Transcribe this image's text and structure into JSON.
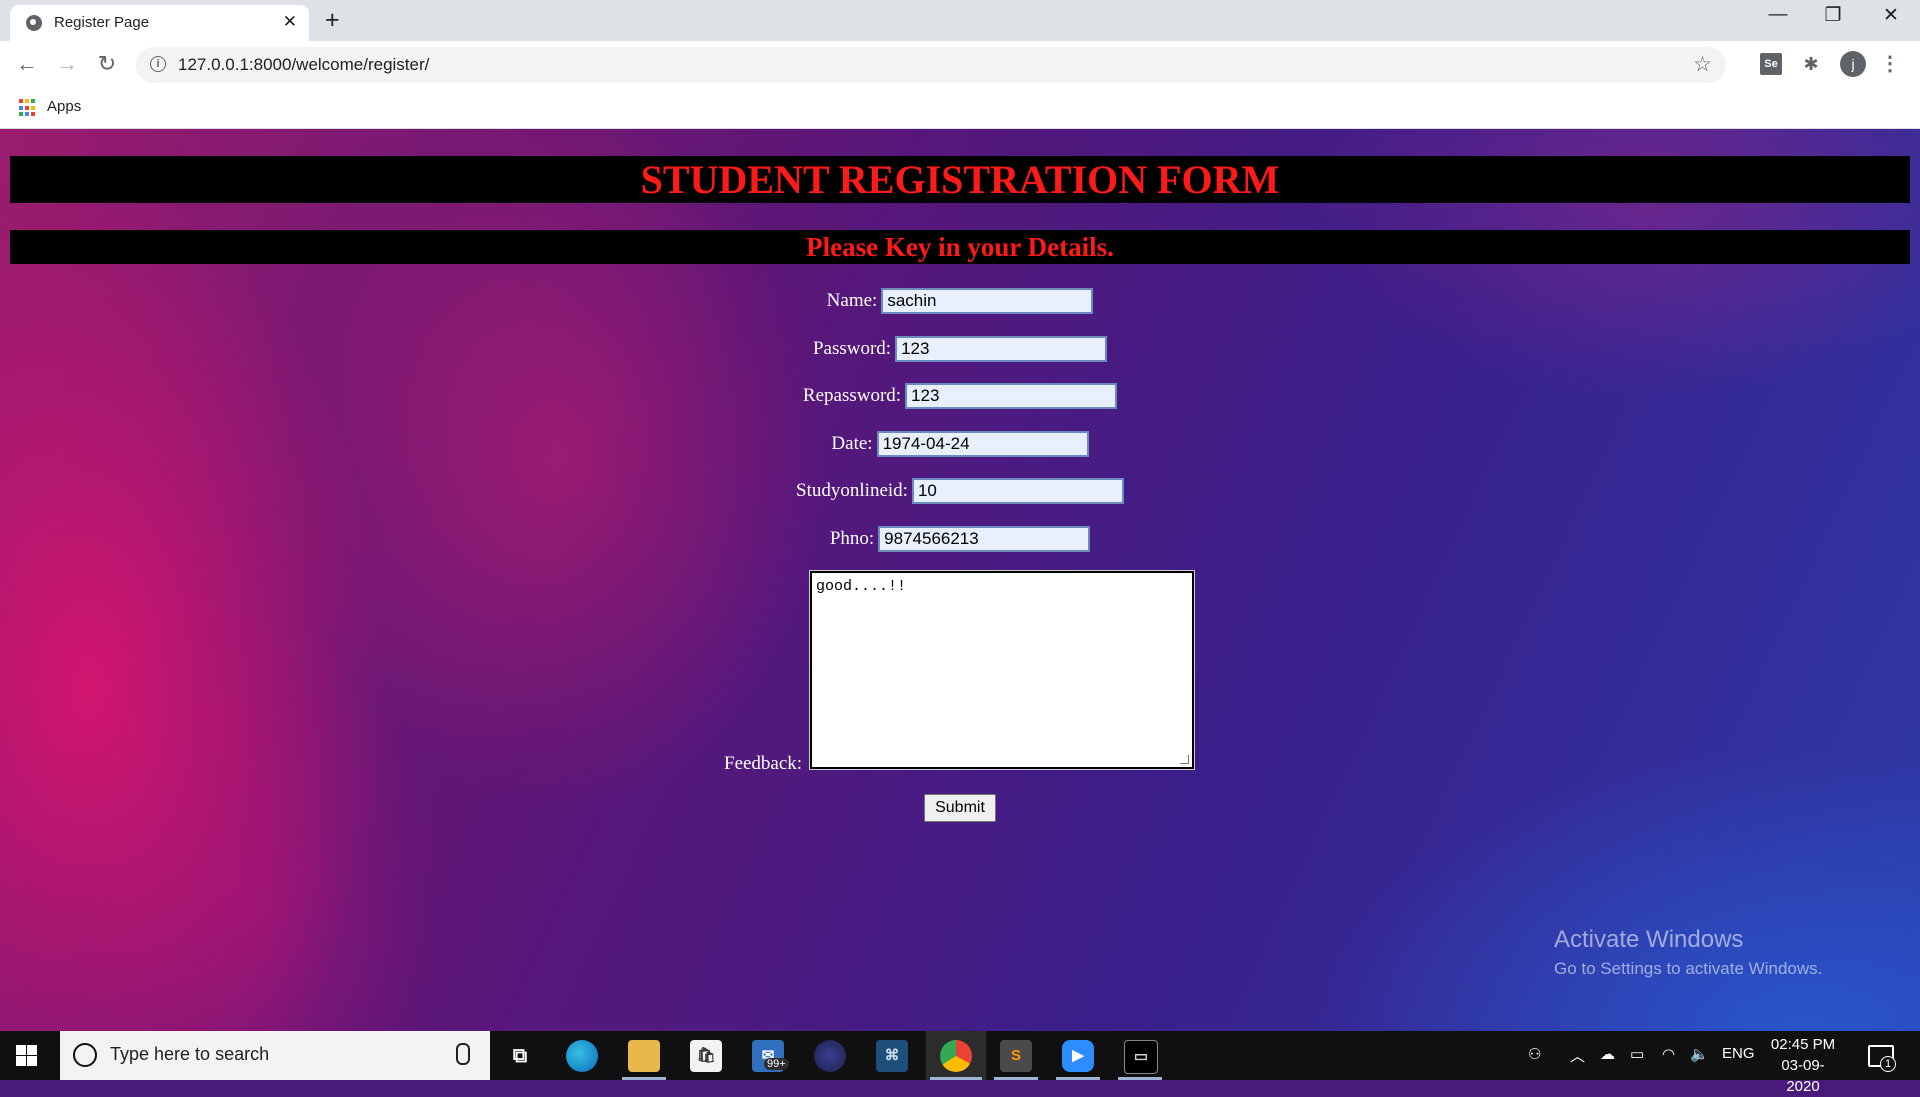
{
  "browser": {
    "tab_title": "Register Page",
    "url": "127.0.0.1:8000/welcome/register/",
    "bookmarks_apps_label": "Apps",
    "profile_initial": "j",
    "extension_se_label": "Se"
  },
  "page": {
    "title": "STUDENT REGISTRATION FORM",
    "subtitle": "Please Key in your Details.",
    "title_color": "#ff1a1a",
    "form": {
      "name_label": "Name:",
      "name_value": "sachin",
      "password_label": "Password:",
      "password_value": "123",
      "repassword_label": "Repassword:",
      "repassword_value": "123",
      "date_label": "Date:",
      "date_value": "1974-04-24",
      "studyonlineid_label": "Studyonlineid:",
      "studyonlineid_value": "10",
      "phno_label": "Phno:",
      "phno_value": "9874566213",
      "feedback_label": "Feedback:",
      "feedback_value": "good....!!",
      "submit_label": "Submit"
    },
    "watermark": {
      "line1": "Activate Windows",
      "line2": "Go to Settings to activate Windows."
    }
  },
  "taskbar": {
    "search_placeholder": "Type here to search",
    "mail_badge": "99+",
    "language": "ENG",
    "time": "02:45 PM",
    "date": "03-09-2020",
    "notification_count": "1"
  }
}
